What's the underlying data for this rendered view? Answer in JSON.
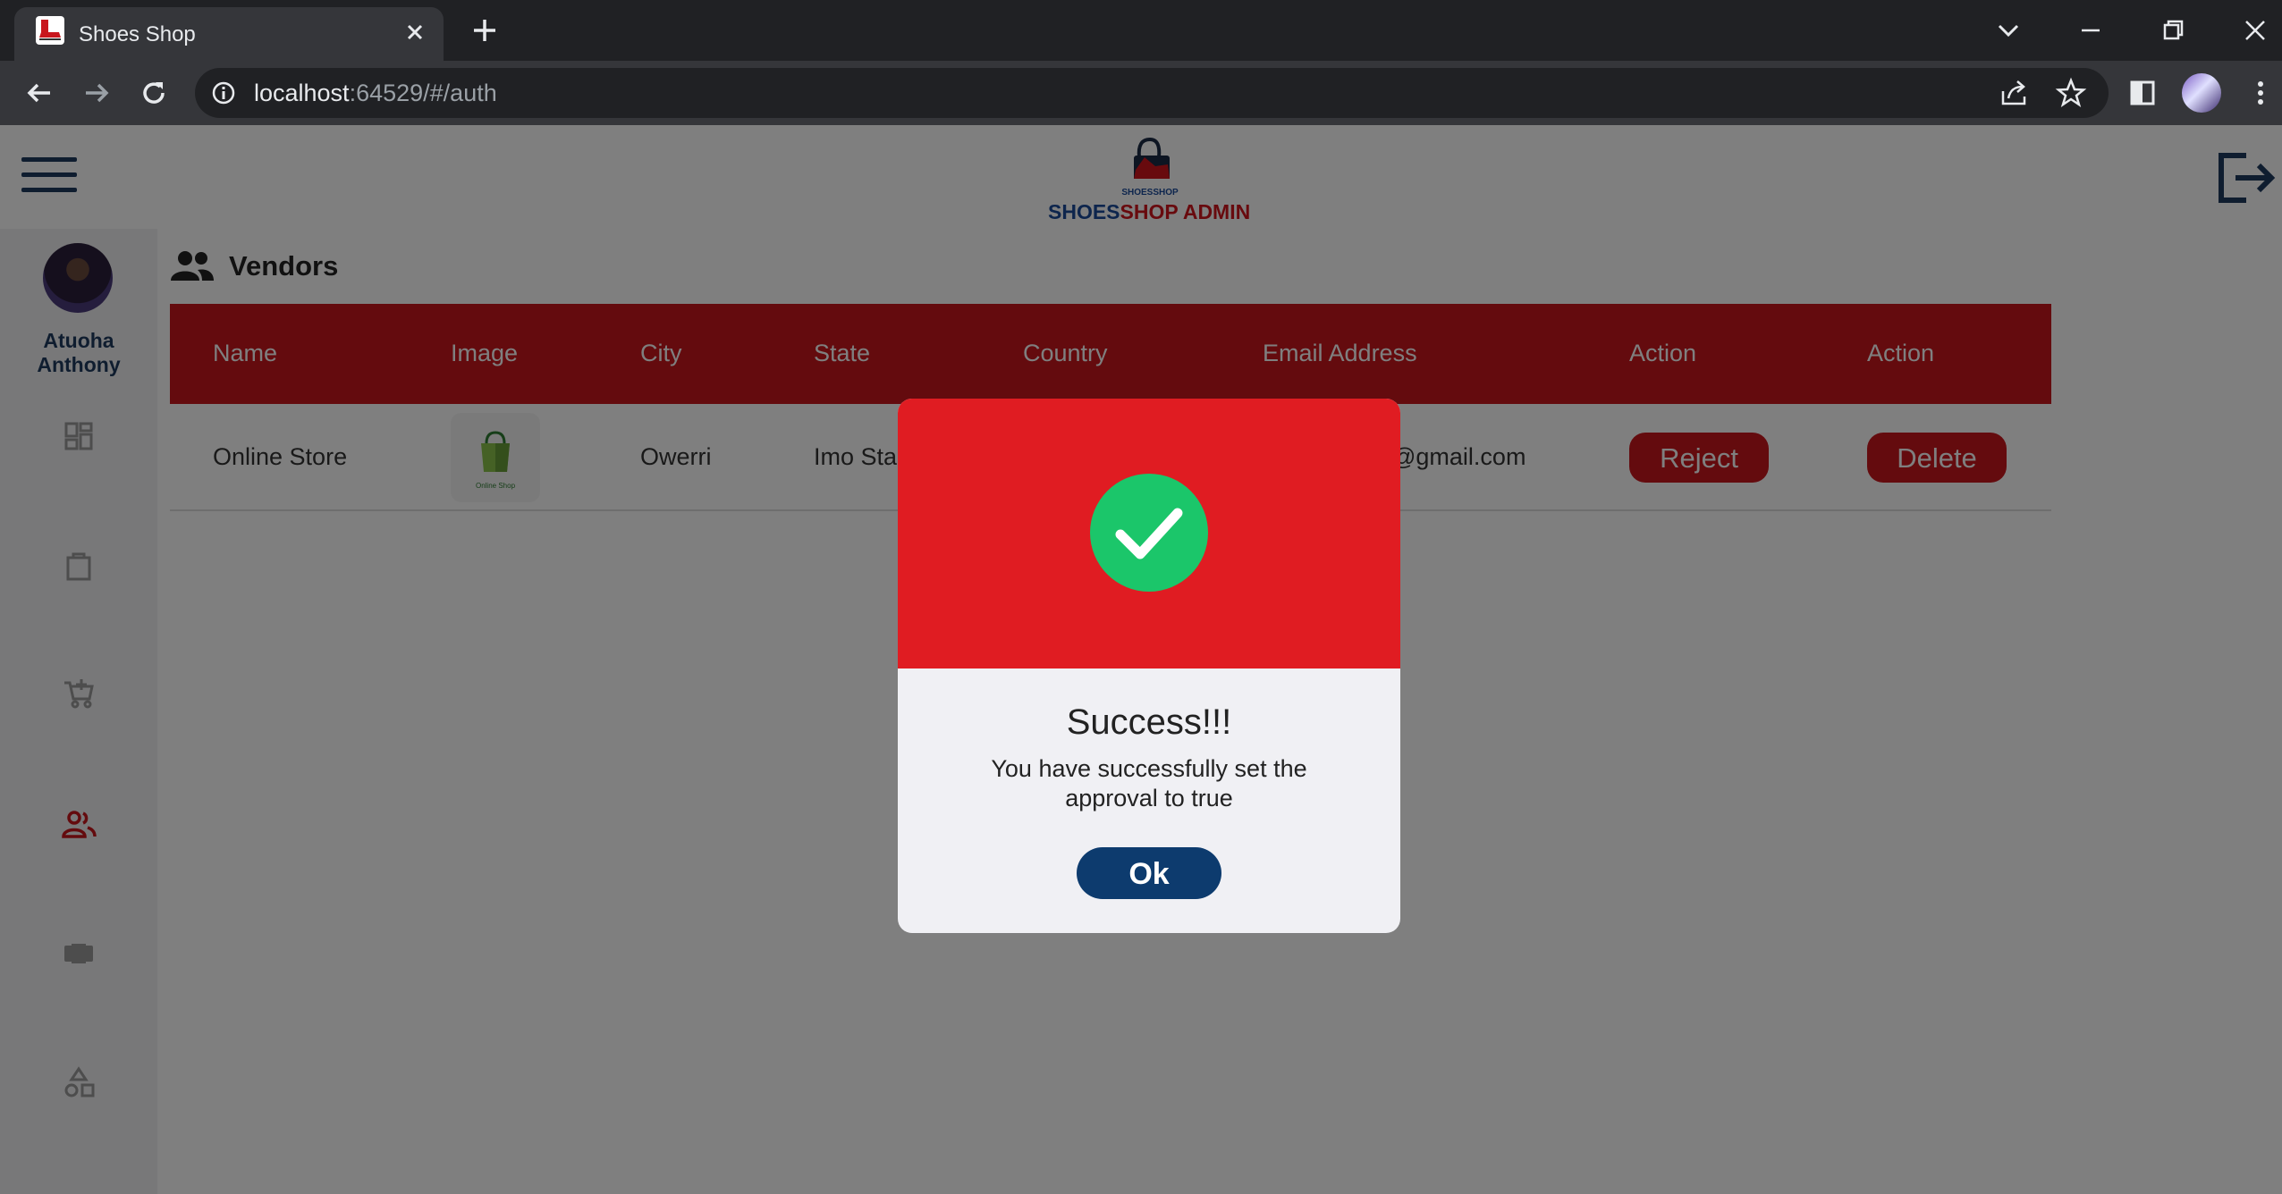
{
  "browser": {
    "tab_title": "Shoes Shop",
    "url_host": "localhost",
    "url_rest": ":64529/#/auth"
  },
  "app": {
    "logo_small": "SHOESSHOP",
    "brand_part1": "SHOES",
    "brand_part2": "SHOP ADMIN",
    "user_name": "Atuoha Anthony",
    "page_title": "Vendors",
    "sidebar_icons": [
      "dashboard-icon",
      "bag-icon",
      "cart-icon",
      "vendors-icon",
      "products-icon",
      "categories-icon"
    ],
    "active_sidebar": "vendors-icon"
  },
  "table": {
    "headers": [
      "Name",
      "Image",
      "City",
      "State",
      "Country",
      "Email Address",
      "Action",
      "Action"
    ],
    "rows": [
      {
        "name": "Online Store",
        "thumb_label": "Online Shop",
        "city": "Owerri",
        "state": "Imo Sta",
        "email": "@gmail.com",
        "action1": "Reject",
        "action2": "Delete"
      }
    ]
  },
  "dialog": {
    "title": "Success!!!",
    "message": "You have successfully set the approval to true",
    "ok_label": "Ok"
  },
  "colors": {
    "brand_red": "#c8161d",
    "dialog_red": "#e01c22",
    "success_green": "#1bc66a",
    "navy": "#0d3b6e"
  }
}
